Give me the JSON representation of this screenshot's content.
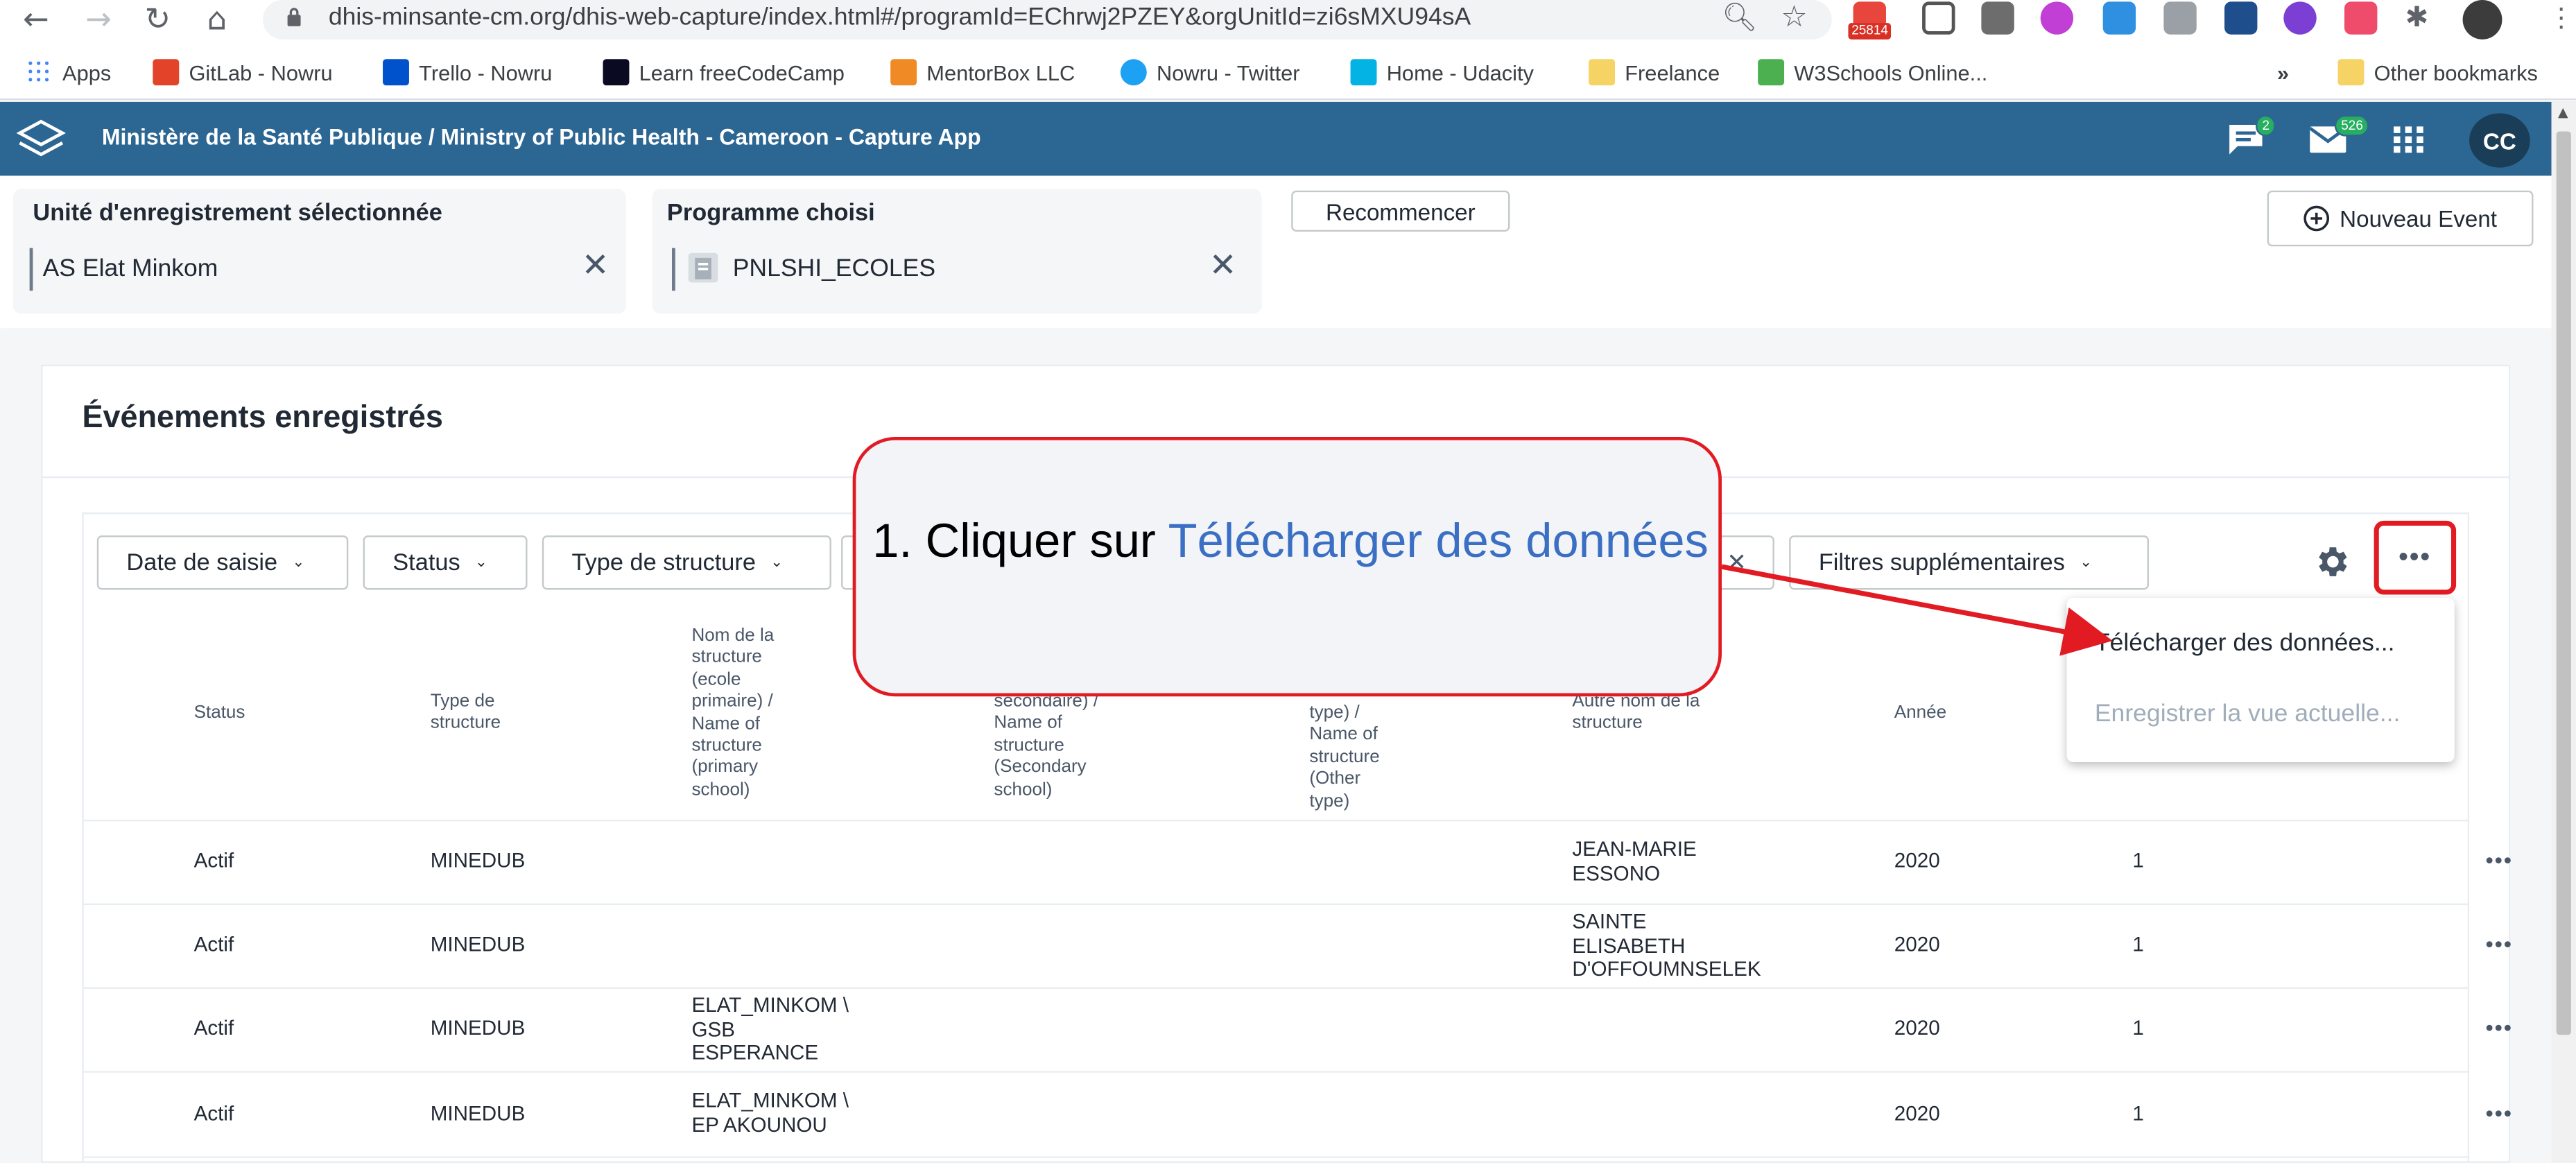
{
  "browser": {
    "url": "dhis-minsante-cm.org/dhis-web-capture/index.html#/programId=EChrwj2PZEY&orgUnitId=zi6sMXU94sA",
    "ext_badge": "25814",
    "bookmarks": [
      {
        "label": "Apps",
        "icon": "apps-grid-icon",
        "color": "#4285f4"
      },
      {
        "label": "GitLab - Nowru",
        "icon": "gitlab-icon",
        "color": "#e24329"
      },
      {
        "label": "Trello - Nowru",
        "icon": "atlassian-icon",
        "color": "#0052cc"
      },
      {
        "label": "Learn freeCodeCamp",
        "icon": "freecodecamp-icon",
        "color": "#0a0a23"
      },
      {
        "label": "MentorBox LLC",
        "icon": "mentorbox-icon",
        "color": "#f08a24"
      },
      {
        "label": "Nowru - Twitter",
        "icon": "twitter-icon",
        "color": "#1da1f2"
      },
      {
        "label": "Home - Udacity",
        "icon": "udacity-icon",
        "color": "#02b3e4"
      },
      {
        "label": "Freelance",
        "icon": "folder-icon",
        "color": "#f6d365"
      },
      {
        "label": "W3Schools Online...",
        "icon": "w3schools-icon",
        "color": "#4caf50"
      }
    ],
    "overflow": "»",
    "other_bookmarks": "Other bookmarks"
  },
  "header": {
    "title": "Ministère de la Santé Publique / Ministry of Public Health - Cameroon - Capture App",
    "messages_badge": "2",
    "mail_badge": "526",
    "avatar_initials": "CC",
    "color": "#2c6693"
  },
  "selection": {
    "org_unit_label": "Unité d'enregistrement sélectionnée",
    "org_unit_value": "AS Elat Minkom",
    "program_label": "Programme choisi",
    "program_value": "PNLSHI_ECOLES",
    "restart_button": "Recommencer",
    "new_event_button": "Nouveau Event"
  },
  "events": {
    "title": "Événements enregistrés",
    "filters": [
      "Date de saisie",
      "Status",
      "Type de structure"
    ],
    "extra_filters": "Filtres supplémentaires",
    "columns": [
      "Status",
      "Type de structure",
      "Nom de la structure (ecole primaire) / Name of structure (primary school)",
      "secondaire) / Name of structure (Secondary school)",
      "type) / Name of structure (Other type)",
      "Autre nom de la structure",
      "Année"
    ],
    "rows": [
      {
        "status": "Actif",
        "type": "MINEDUB",
        "primary": "",
        "other_name": "JEAN-MARIE ESSONO",
        "year": "2020",
        "count": "1"
      },
      {
        "status": "Actif",
        "type": "MINEDUB",
        "primary": "",
        "other_name": "SAINTE ELISABETH D'OFFOUMNSELEK",
        "year": "2020",
        "count": "1"
      },
      {
        "status": "Actif",
        "type": "MINEDUB",
        "primary": "ELAT_MINKOM \\ GSB ESPERANCE",
        "other_name": "",
        "year": "2020",
        "count": "1"
      },
      {
        "status": "Actif",
        "type": "MINEDUB",
        "primary": "ELAT_MINKOM \\ EP AKOUNOU",
        "other_name": "",
        "year": "2020",
        "count": "1"
      }
    ],
    "menu": {
      "download": "Télécharger des données...",
      "save_view": "Enregistrer la vue actuelle..."
    }
  },
  "callout": {
    "prefix": "1. Cliquer sur ",
    "highlight": "Télécharger des données",
    "highlight_color": "#3a6fc4",
    "border_color": "#e21b23"
  }
}
